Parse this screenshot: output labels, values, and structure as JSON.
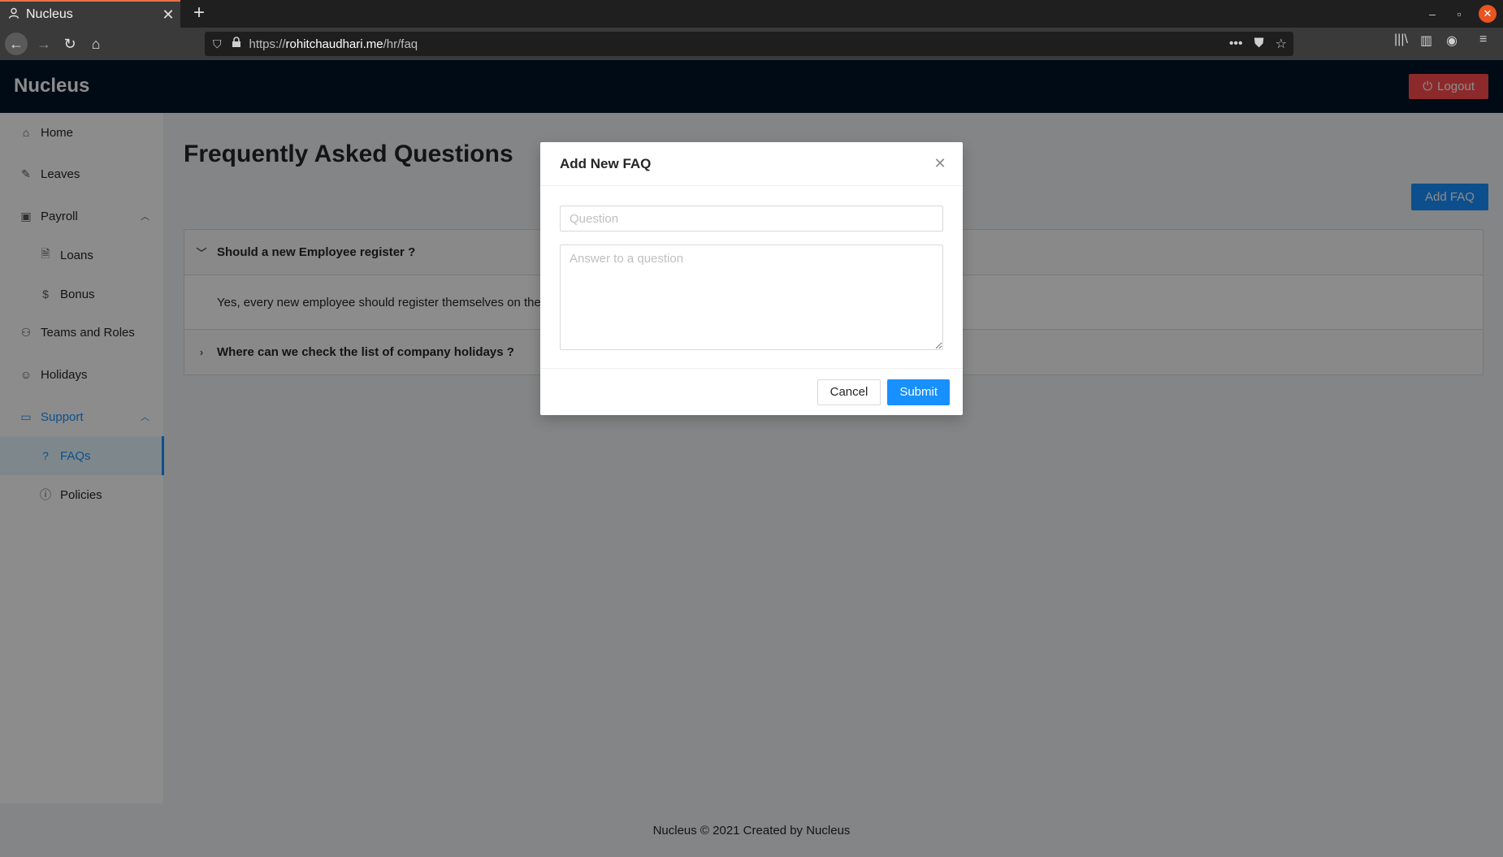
{
  "browser": {
    "tab_title": "Nucleus",
    "url_prefix": "https://",
    "url_host": "rohitchaudhari.me",
    "url_path": "/hr/faq"
  },
  "header": {
    "brand": "Nucleus",
    "logout_label": "Logout"
  },
  "sidebar": {
    "items": [
      {
        "label": "Home",
        "icon": "home-icon"
      },
      {
        "label": "Leaves",
        "icon": "edit-icon"
      },
      {
        "label": "Payroll",
        "icon": "payroll-icon"
      },
      {
        "label": "Loans",
        "icon": "file-icon"
      },
      {
        "label": "Bonus",
        "icon": "dollar-icon"
      },
      {
        "label": "Teams and Roles",
        "icon": "team-icon"
      },
      {
        "label": "Holidays",
        "icon": "smile-icon"
      },
      {
        "label": "Support",
        "icon": "laptop-icon"
      },
      {
        "label": "FAQs",
        "icon": "question-icon"
      },
      {
        "label": "Policies",
        "icon": "info-icon"
      }
    ]
  },
  "main": {
    "title": "Frequently Asked Questions",
    "add_faq_label": "Add FAQ",
    "faqs": [
      {
        "question": "Should a new Employee register ?",
        "answer": "Yes, every new employee should register themselves on the po",
        "expanded": true
      },
      {
        "question": "Where can we check the list of company holidays ?",
        "expanded": false
      }
    ]
  },
  "footer": {
    "text": "Nucleus © 2021 Created by Nucleus"
  },
  "modal": {
    "title": "Add New FAQ",
    "question_placeholder": "Question",
    "answer_placeholder": "Answer to a question",
    "cancel_label": "Cancel",
    "submit_label": "Submit"
  },
  "colors": {
    "primary": "#1890ff",
    "danger": "#ff4d4f",
    "header_bg": "#001529"
  }
}
